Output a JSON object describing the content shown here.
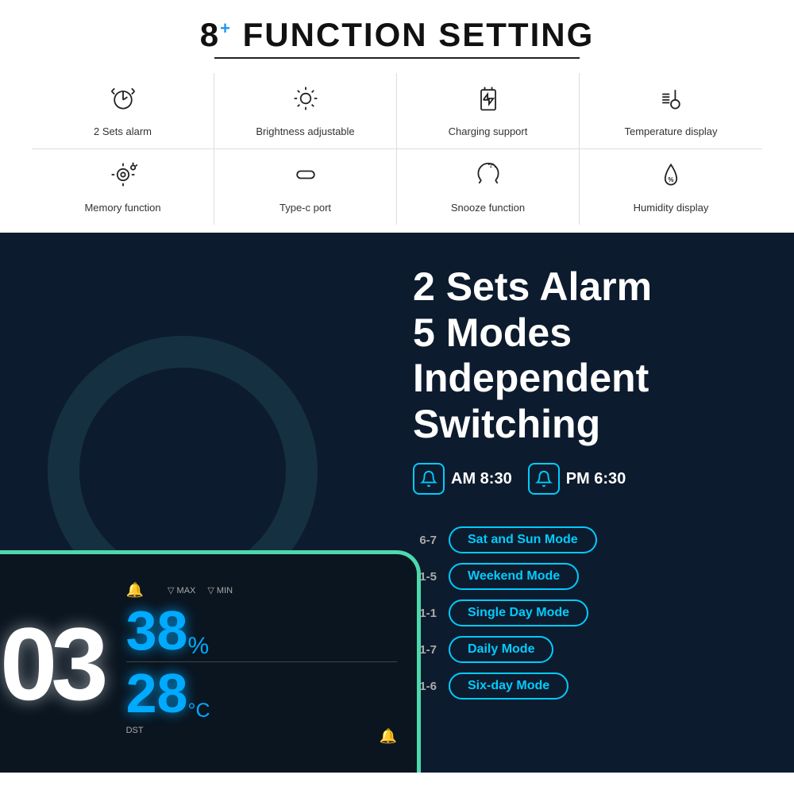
{
  "header": {
    "title_prefix": "8",
    "title_plus": "+",
    "title_suffix": "FUNCTION SETTING"
  },
  "features_row1": [
    {
      "id": "alarm",
      "label": "2 Sets alarm",
      "icon": "⏰"
    },
    {
      "id": "brightness",
      "label": "Brightness adjustable",
      "icon": "💡"
    },
    {
      "id": "charging",
      "label": "Charging support",
      "icon": "🔌"
    },
    {
      "id": "temperature",
      "label": "Temperature display",
      "icon": "🌡️"
    }
  ],
  "features_row2": [
    {
      "id": "memory",
      "label": "Memory function",
      "icon": "⚙️"
    },
    {
      "id": "typec",
      "label": "Type-c port",
      "icon": "🔗"
    },
    {
      "id": "snooze",
      "label": "Snooze function",
      "icon": "😴"
    },
    {
      "id": "humidity",
      "label": "Humidity display",
      "icon": "💧"
    }
  ],
  "bottom": {
    "alarm_heading_line1": "2 Sets Alarm",
    "alarm_heading_line2": "5 Modes Independent Switching",
    "alarm1_label": "AM 8:30",
    "alarm2_label": "PM 6:30",
    "clock_time": "03",
    "humidity_value": "38",
    "humidity_unit": "%",
    "temp_value": "28",
    "temp_unit": "°C",
    "dst_label": "DST",
    "modes": [
      {
        "range": "6-7",
        "label": "Sat and Sun Mode"
      },
      {
        "range": "1-5",
        "label": "Weekend Mode"
      },
      {
        "range": "1-1",
        "label": "Single Day Mode"
      },
      {
        "range": "1-7",
        "label": "Daily Mode"
      },
      {
        "range": "1-6",
        "label": "Six-day Mode"
      }
    ]
  }
}
